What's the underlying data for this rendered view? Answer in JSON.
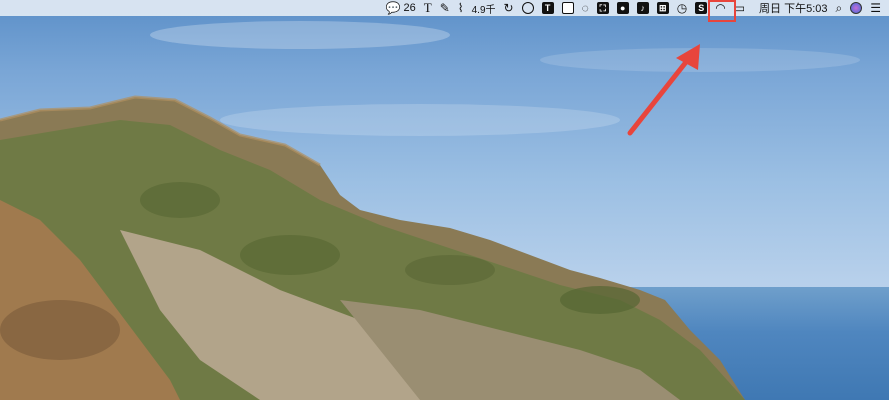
{
  "menubar": {
    "wechat_count": "26",
    "text_tool": "T",
    "partial_label": "4.9千",
    "t_box": "T",
    "datetime": "周日 下午5:03"
  },
  "colors": {
    "annotation": "#e8453c",
    "menubar_bg": "#e4ecf5"
  },
  "icons": [
    "wechat-icon",
    "text-icon",
    "pen-icon",
    "paperclip-icon",
    "refresh-icon",
    "eye-icon",
    "t-box-icon",
    "square-icon",
    "chat-icon",
    "fullscreen-icon",
    "record-icon",
    "mic-icon",
    "grid-icon",
    "clock-icon",
    "s-box-icon",
    "wifi-icon",
    "battery-icon",
    "search-icon",
    "siri-icon",
    "control-center-icon"
  ]
}
